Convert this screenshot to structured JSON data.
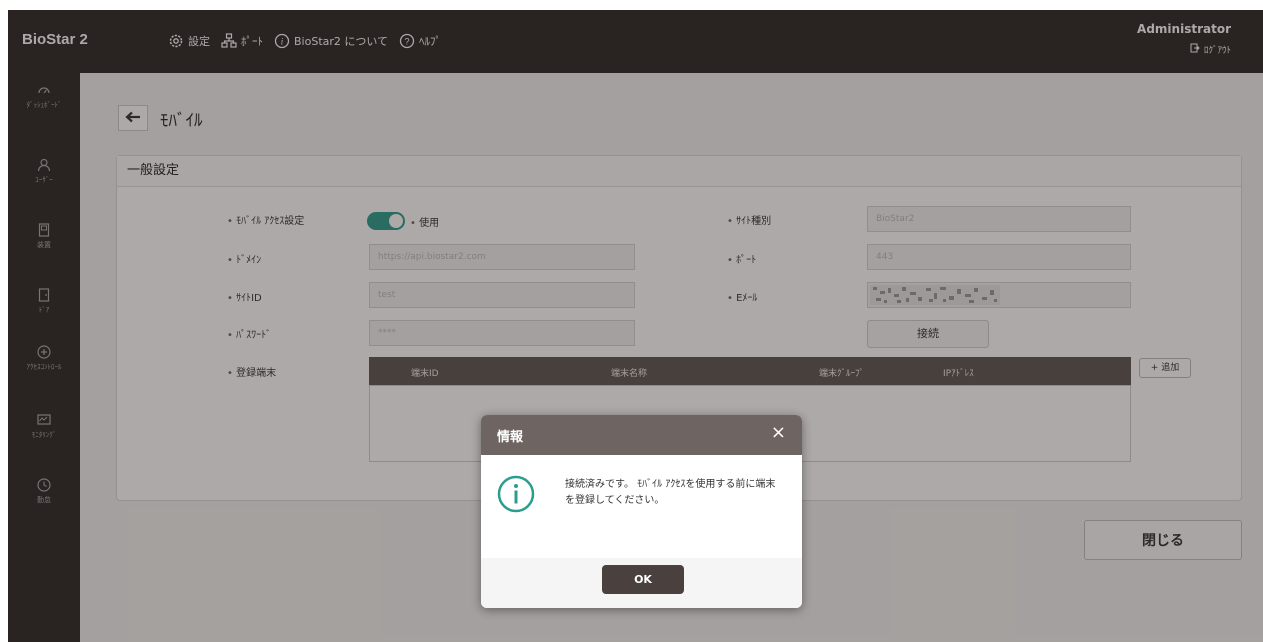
{
  "brand": "BioStar 2",
  "topnav": {
    "settings": "設定",
    "port": "ﾎﾟｰﾄ",
    "about": "BioStar2 について",
    "help": "ﾍﾙﾌﾟ"
  },
  "user": {
    "name": "Administrator",
    "logout": "ﾛｸﾞｱｳﾄ"
  },
  "sidebar": {
    "items": [
      {
        "label": "ﾀﾞｯｼｭﾎﾞｰﾄﾞ",
        "icon": "dashboard-icon"
      },
      {
        "label": "ﾕｰｻﾞｰ",
        "icon": "user-icon"
      },
      {
        "label": "装置",
        "icon": "device-icon"
      },
      {
        "label": "ﾄﾞｱ",
        "icon": "door-icon"
      },
      {
        "label": "ｱｸｾｽｺﾝﾄﾛｰﾙ",
        "icon": "access-control-icon"
      },
      {
        "label": "ﾓﾆﾀﾘﾝｸﾞ",
        "icon": "monitoring-icon"
      },
      {
        "label": "勤怠",
        "icon": "time-attendance-icon"
      }
    ]
  },
  "page": {
    "title": "ﾓﾊﾞｲﾙ"
  },
  "panel": {
    "title": "一般設定",
    "mobile_access_label": "ﾓﾊﾞｲﾙ ｱｸｾｽ設定",
    "mobile_access_toggle_text": "使用",
    "domain_label": "ﾄﾞﾒｲﾝ",
    "domain_value": "https://api.biostar2.com",
    "site_id_label": "ｻｲﾄID",
    "site_id_value": "test",
    "password_label": "ﾊﾟｽﾜｰﾄﾞ",
    "password_value": "****",
    "site_type_label": "ｻｲﾄ種別",
    "site_type_value": "BioStar2",
    "port_label": "ﾎﾟｰﾄ",
    "port_value": "443",
    "email_label": "Eﾒｰﾙ",
    "connect_button": "接続",
    "registered_devices_label": "登録端末",
    "add_button": "+ 追加",
    "table_columns": [
      "端末ID",
      "端末名称",
      "端末ｸﾞﾙｰﾌﾟ",
      "IPｱﾄﾞﾚｽ"
    ]
  },
  "close_button": "閉じる",
  "dialog": {
    "title": "情報",
    "close": "×",
    "message": "接続済みです。 ﾓﾊﾞｲﾙ ｱｸｾｽを使用する前に端末を登録してください。",
    "ok": "OK"
  },
  "colors": {
    "accent": "#2a9d8f",
    "topbar": "#2b2827",
    "dialog_header": "#6e6461",
    "ok_button": "#4a403d"
  }
}
